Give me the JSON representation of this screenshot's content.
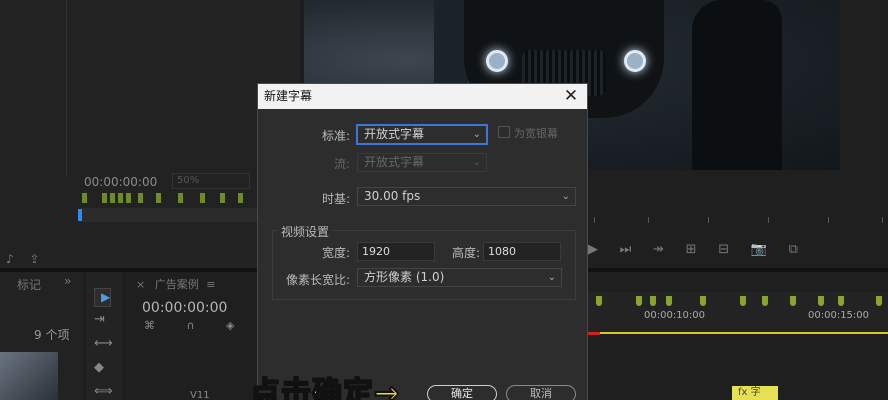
{
  "source_monitor": {
    "timecode": "00:00:00:00",
    "zoom": "50%",
    "tool_icons": "♪ ⇪"
  },
  "program_monitor": {
    "controls": [
      "▶",
      "⏭",
      "↠",
      "⊞",
      "⊟",
      "📷",
      "⧉"
    ]
  },
  "project_panel": {
    "tab": "标记",
    "chevron": "»",
    "item_count": "9 个项"
  },
  "tools": [
    "▶",
    "⇥",
    "⟷",
    "◆",
    "⟺"
  ],
  "timeline": {
    "tab_close": "×",
    "tab_title": "广告案例",
    "tab_menu": "≡",
    "timecode": "00:00:00:00",
    "icons": "⌘ ∩ ◈ ▾",
    "time_labels": [
      "00:00:10:00",
      "00:00:15:00"
    ],
    "track_label": "V11",
    "clip_label": "fx 字"
  },
  "dialog": {
    "title": "新建字幕",
    "close": "✕",
    "standard_label": "标准:",
    "standard_value": "开放式字幕",
    "checkbox_label": "为宽银幕",
    "stream_label": "流:",
    "stream_value": "开放式字幕",
    "timebase_label": "时基:",
    "timebase_value": "30.00 fps",
    "video_settings_title": "视频设置",
    "width_label": "宽度:",
    "width_value": "1920",
    "height_label": "高度:",
    "height_value": "1080",
    "pixel_aspect_label": "像素长宽比:",
    "pixel_aspect_value": "方形像素 (1.0)",
    "ok_label": "确定",
    "cancel_label": "取消"
  },
  "annotation": "点击确定→",
  "colors": {
    "accent_blue": "#3b77d6",
    "marker_green": "#8aa52c",
    "annotation_yellow": "#f6df2c",
    "clip_yellow": "#e7df54"
  }
}
